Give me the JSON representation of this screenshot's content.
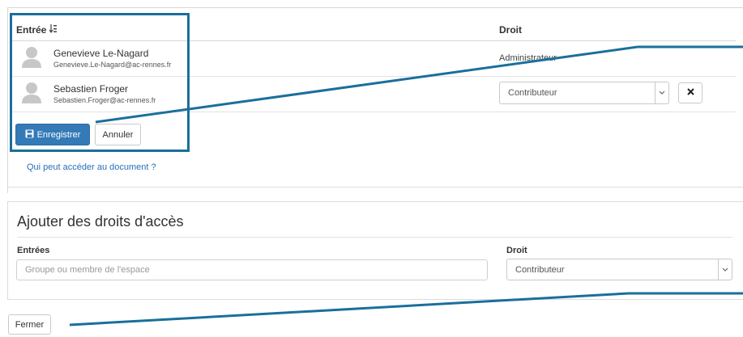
{
  "permissions_table": {
    "col_entry": "Entrée",
    "col_right": "Droit",
    "rows": [
      {
        "name": "Genevieve Le-Nagard",
        "email": "Genevieve.Le-Nagard@ac-rennes.fr",
        "right": "Administrateur"
      },
      {
        "name": "Sebastien Froger",
        "email": "Sebastien.Froger@ac-rennes.fr",
        "right": "Contributeur"
      }
    ]
  },
  "actions": {
    "save_label": "Enregistrer",
    "cancel_label": "Annuler",
    "who_can_access_link": "Qui peut accéder au document ?"
  },
  "add_access": {
    "title": "Ajouter des droits d'accès",
    "entries_label": "Entrées",
    "entries_placeholder": "Groupe ou membre de l'espace",
    "right_label": "Droit",
    "right_value": "Contributeur"
  },
  "footer": {
    "close_label": "Fermer"
  },
  "colors": {
    "primary": "#337ab7",
    "annotation": "#1a6f9b",
    "link": "#2a6ebb"
  },
  "icons": [
    "sort-alpha-icon",
    "user-avatar-icon",
    "save-icon",
    "close-x-icon",
    "chevron-down-icon"
  ]
}
